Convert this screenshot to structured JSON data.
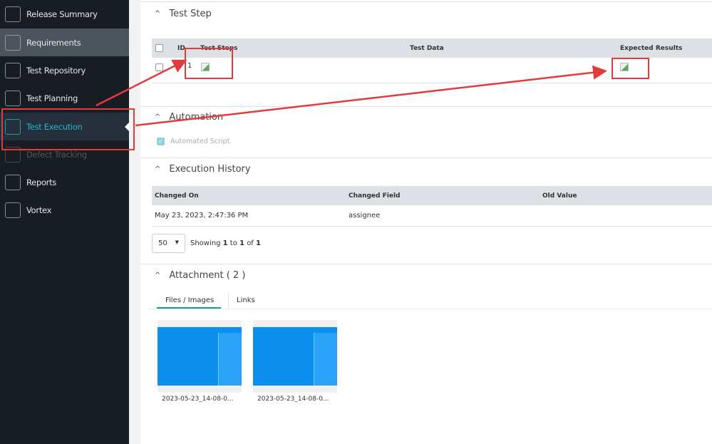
{
  "sidebar": {
    "items": [
      {
        "label": "Release Summary",
        "icon": "release-summary-icon"
      },
      {
        "label": "Requirements",
        "icon": "requirements-icon"
      },
      {
        "label": "Test Repository",
        "icon": "test-repository-icon"
      },
      {
        "label": "Test Planning",
        "icon": "test-planning-icon"
      },
      {
        "label": "Test Execution",
        "icon": "test-execution-icon"
      },
      {
        "label": "Defect Tracking",
        "icon": "defect-tracking-icon"
      },
      {
        "label": "Reports",
        "icon": "reports-icon"
      },
      {
        "label": "Vortex",
        "icon": "vortex-icon"
      }
    ]
  },
  "test_step": {
    "title": "Test Step",
    "columns": [
      "ID",
      "Test Steps",
      "Test Data",
      "Expected Results"
    ],
    "rows": [
      {
        "id": "1"
      }
    ]
  },
  "automation": {
    "title": "Automation",
    "checkbox_label": "Automated Script"
  },
  "history": {
    "title": "Execution History",
    "columns": [
      "Changed On",
      "Changed Field",
      "Old Value"
    ],
    "rows": [
      {
        "changed_on": "May 23, 2023, 2:47:36 PM",
        "field": "assignee"
      }
    ],
    "page_size": "50",
    "showing": "Showing",
    "from": "1",
    "to_word": "to",
    "to": "1",
    "of_word": "of",
    "total": "1"
  },
  "attachment": {
    "title": "Attachment ( 2 )",
    "tabs": [
      "Files / Images",
      "Links"
    ],
    "files": [
      "2023-05-23_14-08-0...",
      "2023-05-23_14-08-0..."
    ]
  },
  "colors": {
    "accent": "#1fb8c9",
    "annotation": "#e23b3b"
  }
}
